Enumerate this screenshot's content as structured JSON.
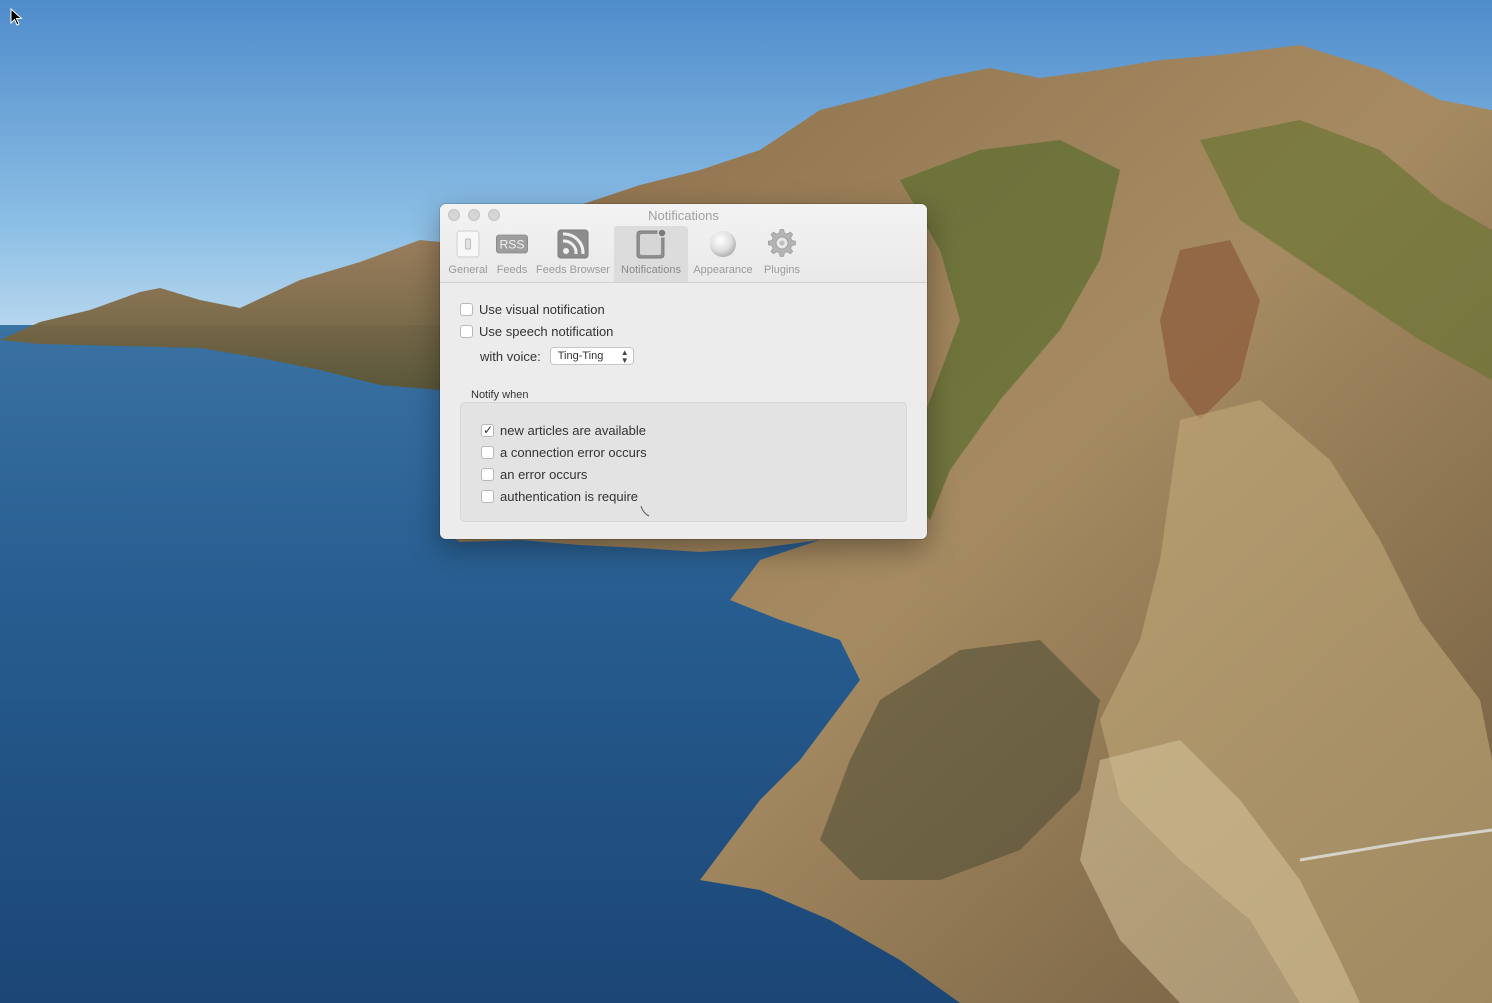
{
  "window": {
    "title": "Notifications"
  },
  "toolbar": {
    "items": [
      {
        "label": "General",
        "icon": "switch-icon"
      },
      {
        "label": "Feeds",
        "icon": "rss-icon"
      },
      {
        "label": "Feeds Browser",
        "icon": "feed-browser-icon"
      },
      {
        "label": "Notifications",
        "icon": "notification-icon",
        "selected": true
      },
      {
        "label": "Appearance",
        "icon": "sphere-icon"
      },
      {
        "label": "Plugins",
        "icon": "gear-icon"
      }
    ],
    "rss_glyph": "RSS"
  },
  "options": {
    "visual_label": "Use visual notification",
    "visual_checked": false,
    "speech_label": "Use speech notification",
    "speech_checked": false,
    "voice_label": "with voice:",
    "voice_value": "Ting-Ting"
  },
  "notify_when": {
    "label": "Notify when",
    "items": [
      {
        "label": "new articles are available",
        "checked": true
      },
      {
        "label": "a connection error occurs",
        "checked": false
      },
      {
        "label": "an error occurs",
        "checked": false
      },
      {
        "label": "authentication is require",
        "checked": false
      }
    ]
  },
  "colors": {
    "window_bg": "#ececec",
    "group_bg": "#e3e3e3"
  }
}
